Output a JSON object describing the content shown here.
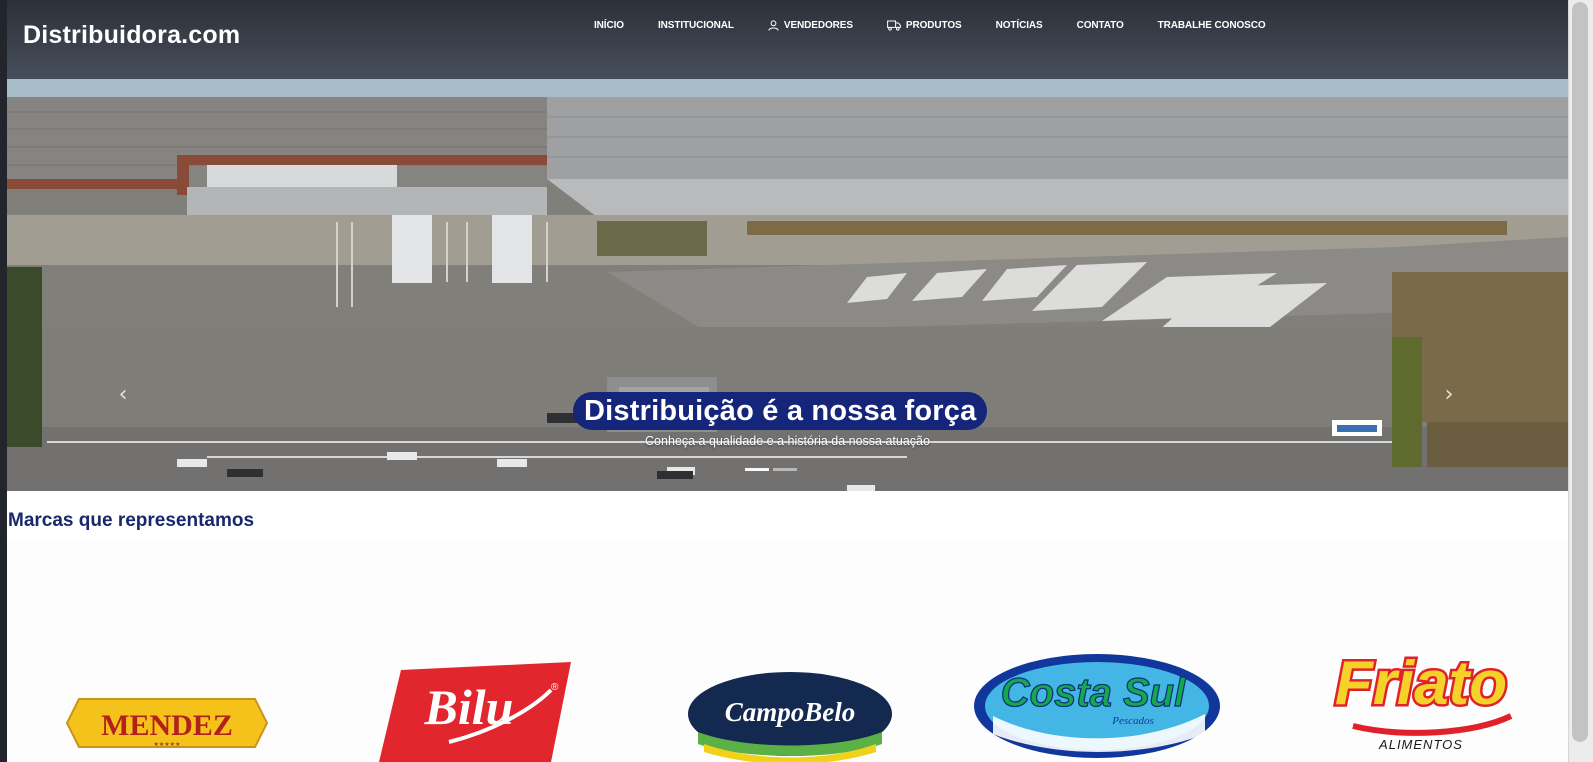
{
  "header": {
    "logo": "Distribuidora.com",
    "nav": [
      {
        "label": "INÍCIO",
        "icon": ""
      },
      {
        "label": "INSTITUCIONAL",
        "icon": ""
      },
      {
        "label": "VENDEDORES",
        "icon": "user-icon"
      },
      {
        "label": "PRODUTOS",
        "icon": "truck-icon"
      },
      {
        "label": "NOTÍCIAS",
        "icon": ""
      },
      {
        "label": "CONTATO",
        "icon": ""
      },
      {
        "label": "TRABALHE CONOSCO",
        "icon": ""
      }
    ]
  },
  "hero": {
    "title": "Distribuição é a nossa força",
    "subtitle": "Conheça a qualidade e a história da nossa atuação",
    "prev_icon": "‹",
    "next_icon": "›",
    "slide_count": 2,
    "active_slide": 0
  },
  "brands": {
    "title": "Marcas que representamos",
    "items": [
      {
        "name": "MENDEZ",
        "stars": "★★★★★"
      },
      {
        "name": "Bilu",
        "mark": "®"
      },
      {
        "name": "CampoBelo"
      },
      {
        "name": "Costa Sul",
        "tagline": "Pescados"
      },
      {
        "name": "Friato",
        "tagline": "ALIMENTOS"
      }
    ]
  },
  "colors": {
    "header_dark": "#2c3038",
    "header_light": "#474e5b",
    "accent_strip": "#a6bcc6",
    "pill": "#15257a",
    "brand_title": "#18286e"
  }
}
